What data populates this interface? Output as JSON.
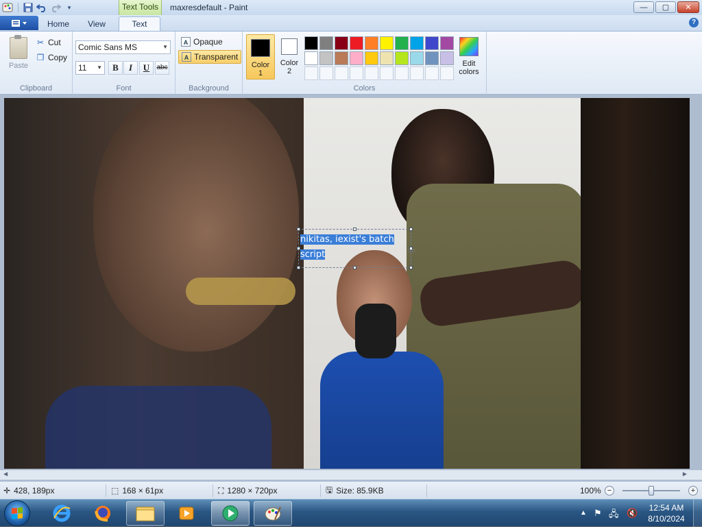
{
  "window": {
    "title": "maxresdefault - Paint",
    "contextual_tab_group": "Text Tools",
    "controls": {
      "minimize": "—",
      "maximize": "▢",
      "close": "✕"
    }
  },
  "quick_access": {
    "save_icon": "save-icon",
    "undo_icon": "undo-icon",
    "redo_icon": "redo-icon",
    "customize_icon": "customize-icon"
  },
  "tabs": [
    {
      "label": "Home",
      "active": false
    },
    {
      "label": "View",
      "active": false
    },
    {
      "label": "Text",
      "active": true
    }
  ],
  "ribbon": {
    "clipboard": {
      "label": "Clipboard",
      "paste": "Paste",
      "cut": "Cut",
      "copy": "Copy"
    },
    "font": {
      "label": "Font",
      "family": "Comic Sans MS",
      "size": "11",
      "bold": "B",
      "italic": "I",
      "underline": "U",
      "strikethrough": "abc"
    },
    "background": {
      "label": "Background",
      "opaque": "Opaque",
      "transparent": "Transparent",
      "selected": "transparent"
    },
    "colors": {
      "label": "Colors",
      "color1_line1": "Color",
      "color1_line2": "1",
      "color2_line1": "Color",
      "color2_line2": "2",
      "color1": "#000000",
      "color2": "#ffffff",
      "edit_line1": "Edit",
      "edit_line2": "colors",
      "palette_row1": [
        "#000000",
        "#7f7f7f",
        "#880015",
        "#ed1c24",
        "#ff7f27",
        "#fff200",
        "#22b14c",
        "#00a2e8",
        "#3f48cc",
        "#a349a4"
      ],
      "palette_row2": [
        "#ffffff",
        "#c3c3c3",
        "#b97a57",
        "#ffaec9",
        "#ffc90e",
        "#efe4b0",
        "#b5e61d",
        "#99d9ea",
        "#7092be",
        "#c8bfe7"
      ]
    }
  },
  "canvas": {
    "text_line1": "nikitas, iexist's batch",
    "text_line2": "script"
  },
  "status": {
    "cursor_pos": "428, 189px",
    "selection_size": "168 × 61px",
    "image_size": "1280 × 720px",
    "file_size": "Size: 85.9KB",
    "zoom": "100%"
  },
  "taskbar": {
    "apps": [
      {
        "name": "internet-explorer",
        "open": false
      },
      {
        "name": "firefox",
        "open": false
      },
      {
        "name": "file-explorer",
        "open": true
      },
      {
        "name": "media-player",
        "open": false
      },
      {
        "name": "media-center",
        "open": true
      },
      {
        "name": "paint",
        "open": true
      }
    ],
    "time": "12:54 AM",
    "date": "8/10/2024"
  }
}
